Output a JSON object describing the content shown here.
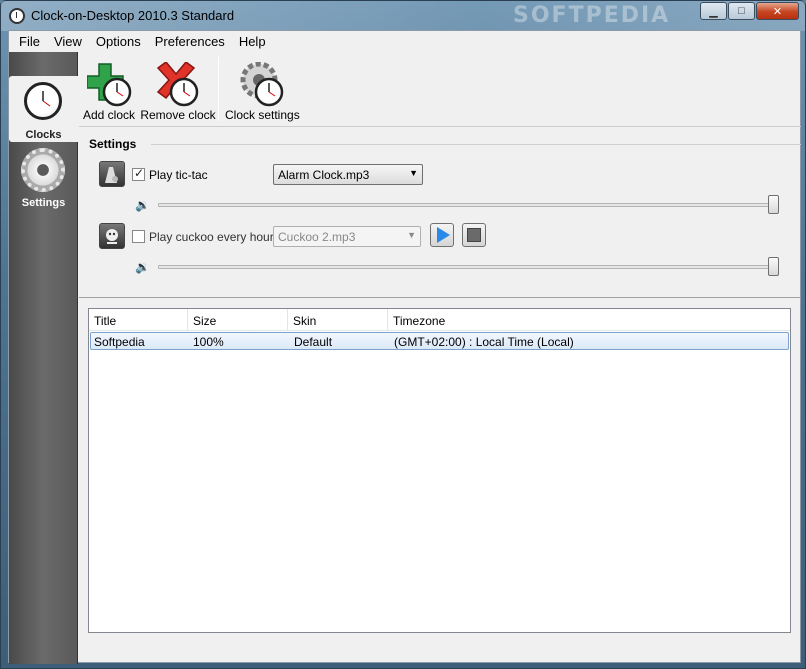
{
  "window": {
    "title": "Clock-on-Desktop 2010.3 Standard",
    "watermark": "SOFTPEDIA"
  },
  "menu": [
    "File",
    "View",
    "Options",
    "Preferences",
    "Help"
  ],
  "nav": [
    {
      "label": "Clocks",
      "icon": "clock-icon"
    },
    {
      "label": "Settings",
      "icon": "gear-icon"
    }
  ],
  "toolbar": {
    "add_label": "Add clock",
    "remove_label": "Remove clock",
    "settings_label": "Clock settings"
  },
  "settings": {
    "title": "Settings",
    "tictac": {
      "label": "Play tic-tac",
      "checked": true,
      "sound": "Alarm Clock.mp3",
      "volume": 1.0
    },
    "cuckoo": {
      "label": "Play cuckoo every hour",
      "checked": false,
      "sound": "Cuckoo 2.mp3",
      "volume": 1.0
    }
  },
  "table": {
    "columns": [
      "Title",
      "Size",
      "Skin",
      "Timezone"
    ],
    "rows": [
      [
        "Softpedia",
        "100%",
        "Default",
        "(GMT+02:00) : Local Time (Local)"
      ]
    ]
  },
  "colors": {
    "accent": "#2a88e6",
    "selection": "#dbe9f8"
  }
}
